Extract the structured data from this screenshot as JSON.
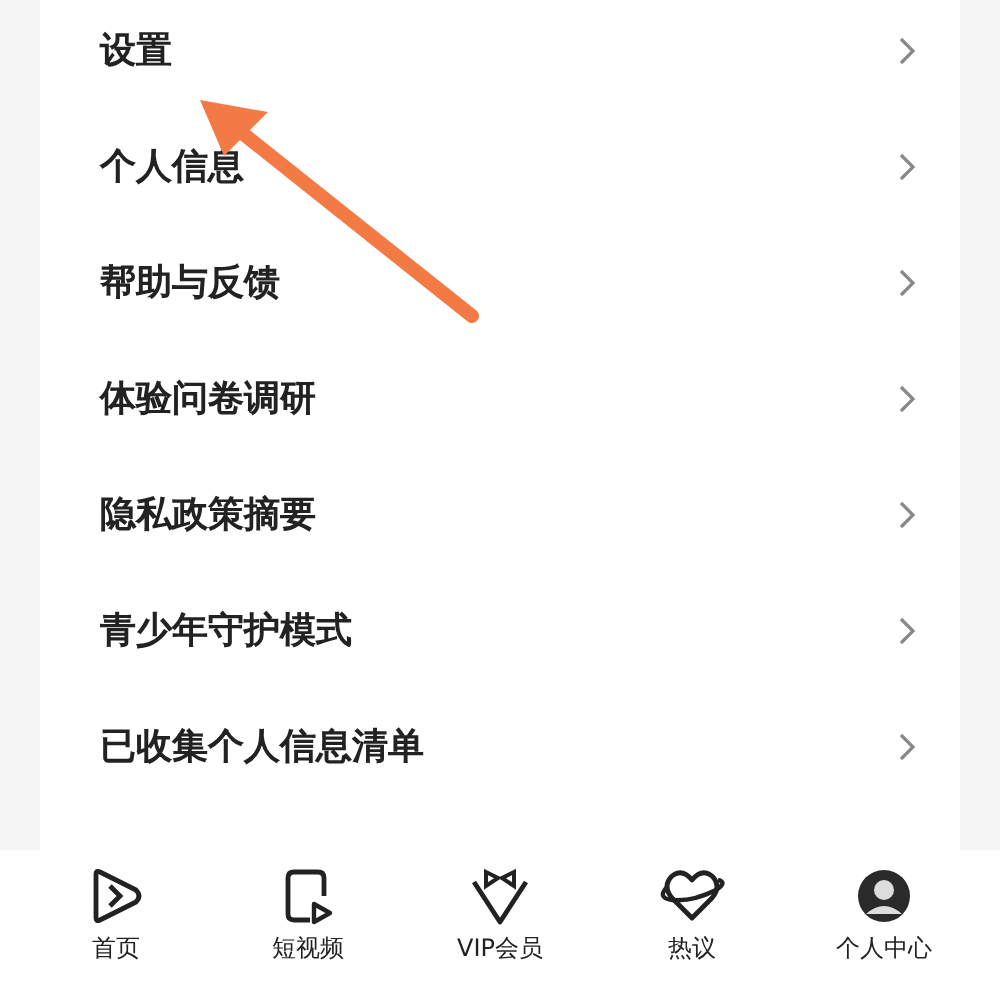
{
  "menu": [
    {
      "label": "设置"
    },
    {
      "label": "个人信息"
    },
    {
      "label": "帮助与反馈"
    },
    {
      "label": "体验问卷调研"
    },
    {
      "label": "隐私政策摘要"
    },
    {
      "label": "青少年守护模式"
    },
    {
      "label": "已收集个人信息清单"
    }
  ],
  "tab_bar": [
    {
      "label": "首页",
      "kind": "home"
    },
    {
      "label": "短视频",
      "kind": "video"
    },
    {
      "label": "VIP会员",
      "kind": "vip"
    },
    {
      "label": "热议",
      "kind": "planet"
    },
    {
      "label": "个人中心",
      "kind": "avatar"
    }
  ]
}
